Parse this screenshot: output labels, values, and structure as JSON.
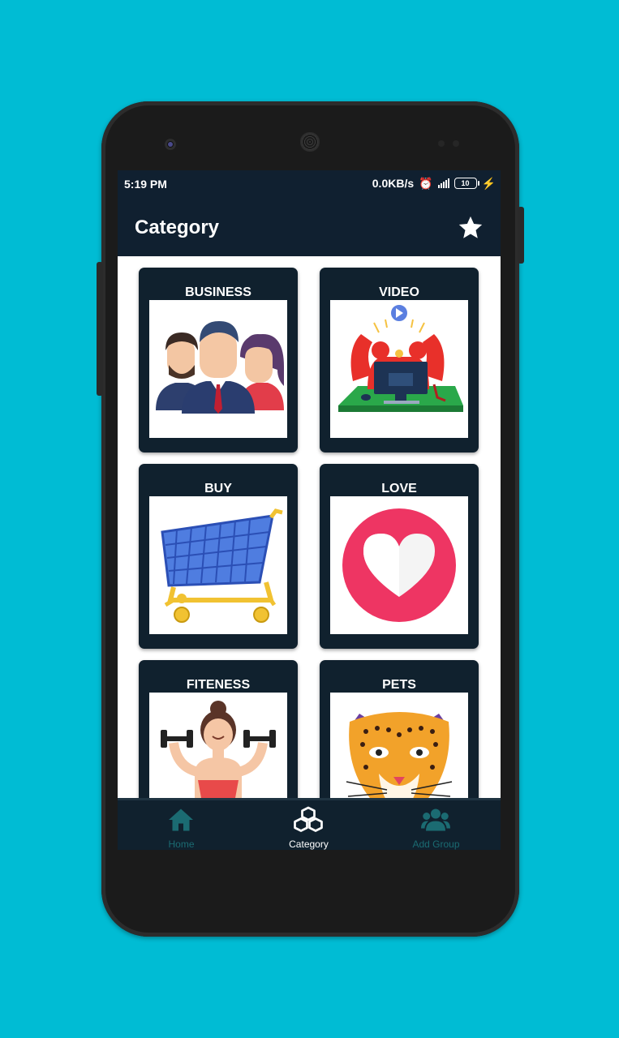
{
  "status_bar": {
    "time": "5:19 PM",
    "speed": "0.0KB/s",
    "battery": "10"
  },
  "app_bar": {
    "title": "Category"
  },
  "categories": [
    {
      "label": "BUSINESS"
    },
    {
      "label": "VIDEO"
    },
    {
      "label": "BUY"
    },
    {
      "label": "LOVE"
    },
    {
      "label": "FITENESS"
    },
    {
      "label": "PETS"
    }
  ],
  "bottom_nav": [
    {
      "label": "Home",
      "icon": "home-icon",
      "active": false
    },
    {
      "label": "Category",
      "icon": "cubes-icon",
      "active": true
    },
    {
      "label": "Add Group",
      "icon": "group-icon",
      "active": false
    }
  ],
  "colors": {
    "background": "#00BCD4",
    "app_bar": "#102030",
    "card": "#10212e",
    "nav_active": "#ffffff",
    "nav_inactive": "#1b6b72"
  }
}
